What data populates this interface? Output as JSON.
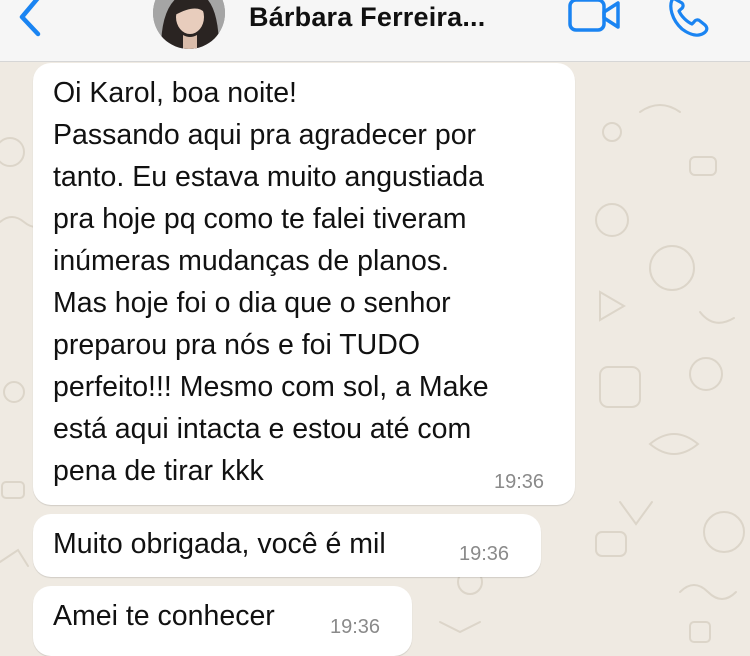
{
  "header": {
    "contact_name": "Bárbara Ferreira...",
    "icons": [
      "back-icon",
      "avatar",
      "video-call-icon",
      "voice-call-icon"
    ],
    "accent_color": "#1a84f2"
  },
  "messages": [
    {
      "text": "Oi Karol, boa noite!\nPassando aqui pra agradecer por\ntanto. Eu estava muito angustiada\npra hoje pq como te falei tiveram\ninúmeras mudanças de planos.\nMas hoje foi o dia que o senhor\npreparou pra nós e foi TUDO\nperfeito!!! Mesmo com sol, a Make\nestá aqui intacta e estou até com\npena de tirar kkk",
      "time": "19:36"
    },
    {
      "text": "Muito obrigada, você é mil",
      "time": "19:36"
    },
    {
      "text": "Amei te conhecer",
      "time": "19:36"
    }
  ],
  "colors": {
    "header_bg": "#f6f6f6",
    "chat_bg": "#efeae2",
    "bubble_bg": "#ffffff",
    "timestamp": "#8a8a8a"
  }
}
